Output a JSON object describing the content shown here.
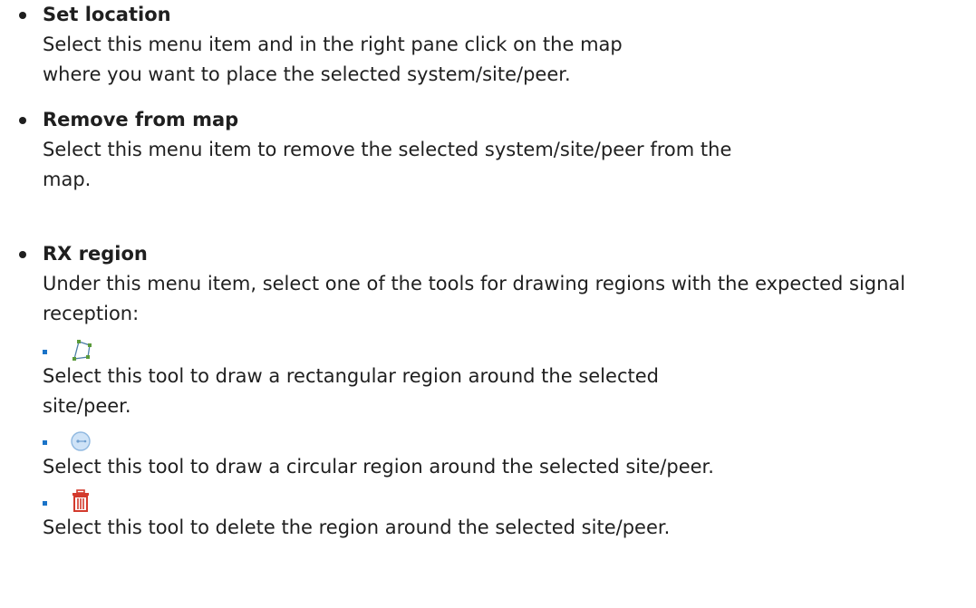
{
  "items": [
    {
      "title": "Set location",
      "description": "Select this menu item and in the right pane click on the map where you want to place the selected system/site/peer."
    },
    {
      "title": "Remove from map",
      "description": "Select this menu item to remove the selected system/site/peer from the map."
    },
    {
      "title": "RX region",
      "description": "Under this menu item, select one of the tools for drawing regions with the expected signal reception:",
      "tools": [
        {
          "icon": "draw-polygon-icon",
          "description": "Select this tool to draw a rectangular region around the selected site/peer."
        },
        {
          "icon": "draw-circle-icon",
          "description": "Select this tool to draw a circular region around the selected site/peer."
        },
        {
          "icon": "trash-icon",
          "description": "Select this tool to delete the region around the selected site/peer."
        }
      ]
    }
  ]
}
